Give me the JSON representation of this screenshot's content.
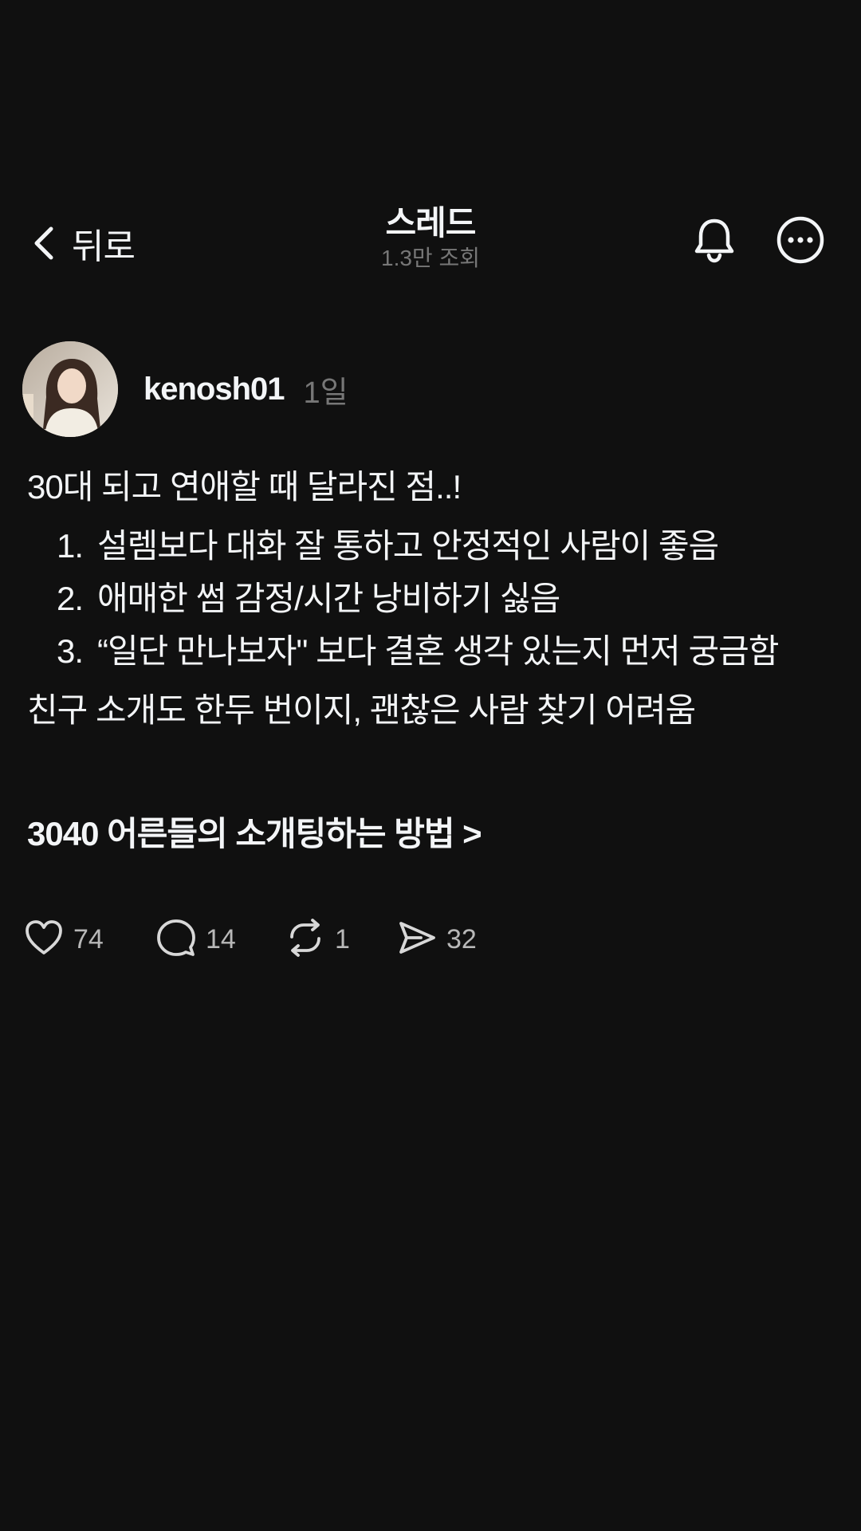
{
  "header": {
    "back_label": "뒤로",
    "title": "스레드",
    "views": "1.3만 조회"
  },
  "post": {
    "author": {
      "username": "kenosh01",
      "time": "1일"
    },
    "intro": "30대 되고 연애할 때 달라진 점..!",
    "list": [
      {
        "num": "1.",
        "text": "설렘보다 대화 잘 통하고 안정적인 사람이 좋음"
      },
      {
        "num": "2.",
        "text": "애매한 썸 감정/시간 낭비하기 싫음"
      },
      {
        "num": "3.",
        "text": "“일단 만나보자\" 보다 결혼 생각 있는지 먼저 궁금함"
      }
    ],
    "outro": "친구 소개도 한두 번이지, 괜찮은 사람 찾기 어려움",
    "link_text": "3040 어른들의 소개팅하는 방법 >"
  },
  "actions": {
    "likes": "74",
    "comments": "14",
    "reposts": "1",
    "shares": "32"
  },
  "icons": {
    "back": "chevron-left-icon",
    "bell": "bell-icon",
    "more": "more-circle-icon",
    "like": "heart-icon",
    "comment": "comment-bubble-icon",
    "repost": "repost-icon",
    "share": "send-icon"
  },
  "colors": {
    "background": "#101010",
    "text": "#f3f5f7",
    "secondary": "#777777",
    "action_count": "#b8b8b8"
  }
}
